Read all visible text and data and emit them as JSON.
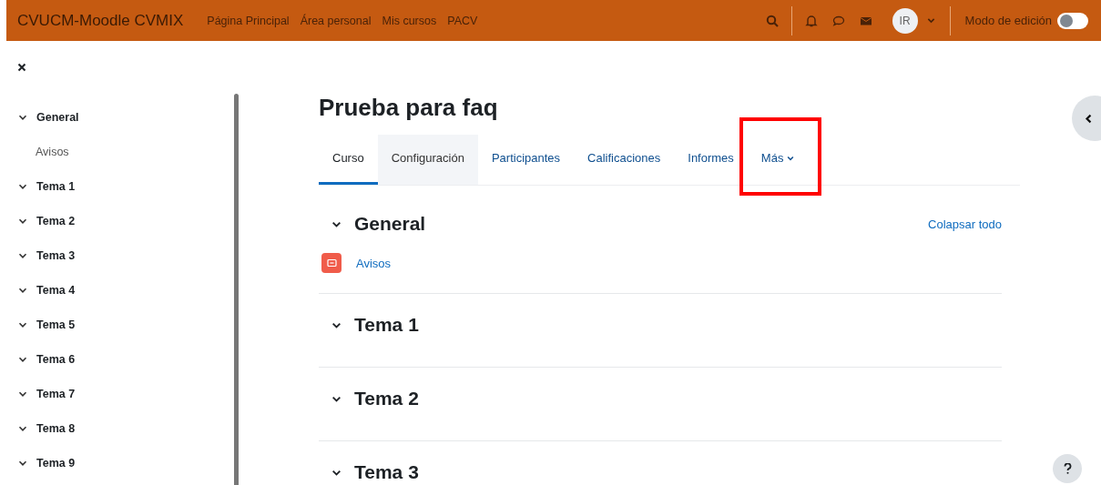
{
  "navbar": {
    "brand": "CVUCM-Moodle CVMIX",
    "links": [
      "Página Principal",
      "Área personal",
      "Mis cursos",
      "PACV"
    ],
    "avatar": "IR",
    "edit_mode": {
      "label": "Modo de edición",
      "on": false
    }
  },
  "course_index": {
    "items": [
      {
        "label": "General",
        "expanded": true,
        "children": [
          {
            "label": "Avisos"
          }
        ]
      },
      {
        "label": "Tema 1",
        "expanded": true
      },
      {
        "label": "Tema 2",
        "expanded": true
      },
      {
        "label": "Tema 3",
        "expanded": true
      },
      {
        "label": "Tema 4",
        "expanded": true
      },
      {
        "label": "Tema 5",
        "expanded": true
      },
      {
        "label": "Tema 6",
        "expanded": true
      },
      {
        "label": "Tema 7",
        "expanded": true
      },
      {
        "label": "Tema 8",
        "expanded": true
      },
      {
        "label": "Tema 9",
        "expanded": true
      }
    ]
  },
  "course": {
    "title": "Prueba para faq",
    "tabs": [
      {
        "label": "Curso",
        "selected": true,
        "hovered": false
      },
      {
        "label": "Configuración",
        "selected": false,
        "hovered": true
      },
      {
        "label": "Participantes",
        "selected": false,
        "hovered": false
      },
      {
        "label": "Calificaciones",
        "selected": false,
        "hovered": false
      },
      {
        "label": "Informes",
        "selected": false,
        "hovered": false
      },
      {
        "label": "Más",
        "selected": false,
        "hovered": false,
        "highlighted": true
      }
    ],
    "collapse_all": "Colapsar todo",
    "sections": [
      {
        "title": "General",
        "expanded": true,
        "activities": [
          {
            "name": "Avisos"
          }
        ]
      },
      {
        "title": "Tema 1",
        "expanded": true
      },
      {
        "title": "Tema 2",
        "expanded": true
      },
      {
        "title": "Tema 3",
        "expanded": true
      }
    ]
  }
}
